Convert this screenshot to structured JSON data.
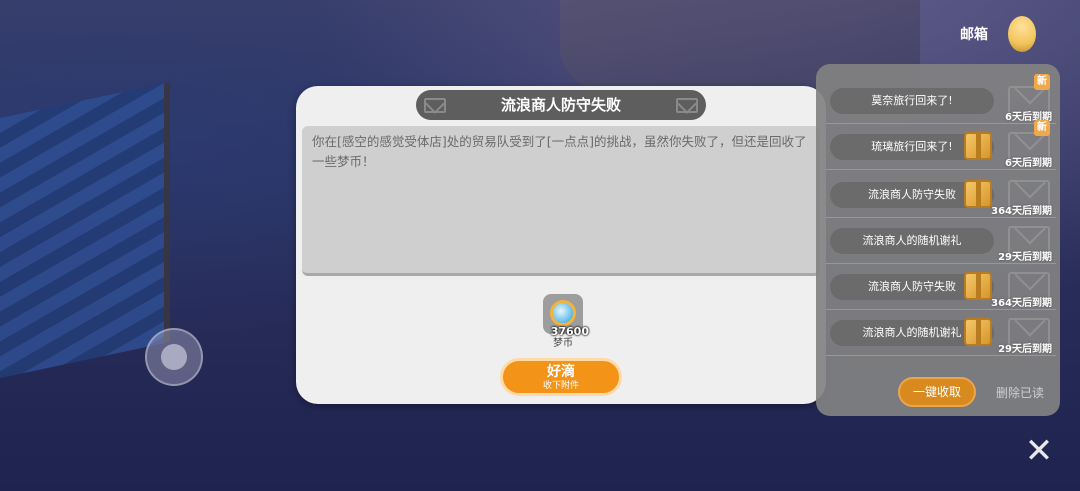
{
  "dialog": {
    "title": "流浪商人防守失败",
    "message": "你在[感空的感觉受体店]处的贸易队受到了[一点点]的挑战，虽然你失败了，但还是回收了一些梦币！",
    "attachment": {
      "amount": "37600",
      "label": "梦币",
      "icon": "dream-coin-icon"
    },
    "ok_button": {
      "label": "好滴",
      "sublabel": "收下附件"
    }
  },
  "mailbox": {
    "title": "邮箱",
    "items": [
      {
        "title": "莫奈旅行回来了!",
        "expire": "6天后到期",
        "is_new": true,
        "new_label": "新",
        "has_attachment": false
      },
      {
        "title": "琉璃旅行回来了!",
        "expire": "6天后到期",
        "is_new": true,
        "new_label": "新",
        "has_attachment": true
      },
      {
        "title": "流浪商人防守失败",
        "expire": "364天后到期",
        "is_new": false,
        "has_attachment": true
      },
      {
        "title": "流浪商人的随机谢礼",
        "expire": "29天后到期",
        "is_new": false,
        "has_attachment": false
      },
      {
        "title": "流浪商人防守失败",
        "expire": "364天后到期",
        "is_new": false,
        "has_attachment": true
      },
      {
        "title": "流浪商人的随机谢礼",
        "expire": "29天后到期",
        "is_new": false,
        "has_attachment": true
      }
    ],
    "collect_all_label": "一键收取",
    "delete_read_label": "删除已读"
  },
  "close_label": "✕",
  "colors": {
    "accent": "#f39318",
    "panel": "#828282",
    "dialog": "#efefef"
  }
}
